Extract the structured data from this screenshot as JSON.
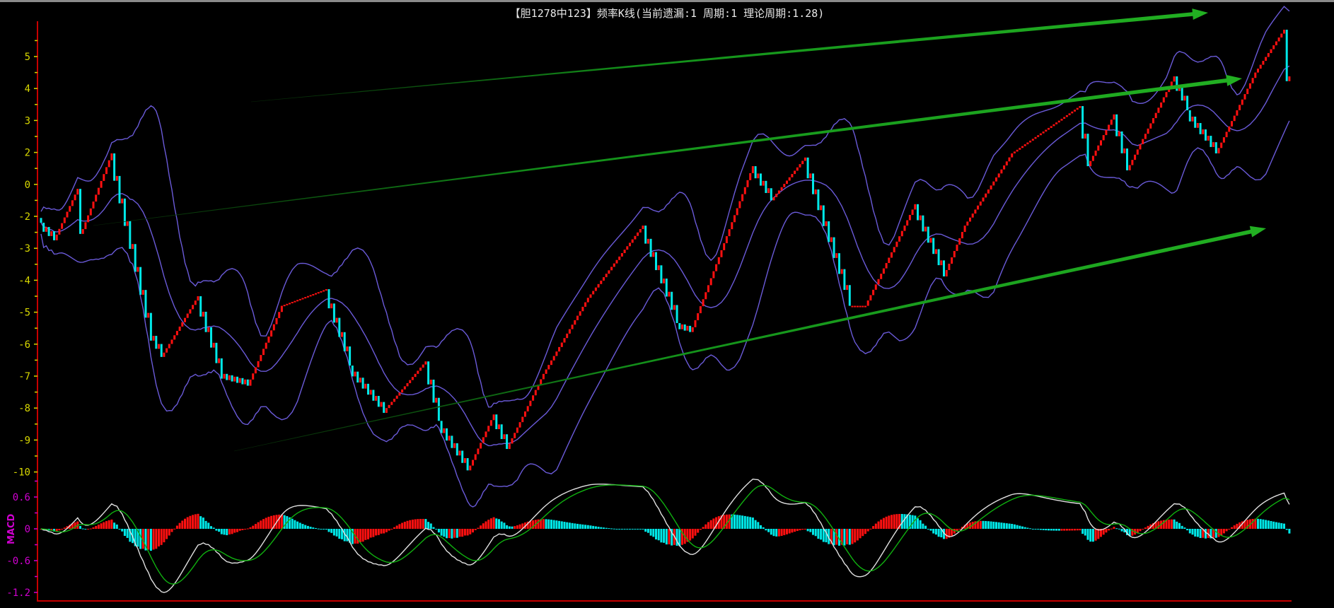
{
  "title": "【胆1278中123】频率K线(当前遗漏:1 周期:1 理论周期:1.28)",
  "colors": {
    "up": "#ff1010",
    "down": "#00e8e8",
    "band": "#6a5ad8",
    "axis": "#c80000",
    "tick_text": "#d8d800",
    "macd_text": "#d000d0",
    "dif": "#e0e0e0",
    "dea": "#10b010",
    "arrow": "#22b022"
  },
  "chart_data": [
    {
      "type": "candlestick",
      "title": "【胆1278中123】频率K线(当前遗漏:1 周期:1 理论周期:1.28)",
      "y_tick_labels": [
        "5",
        "4",
        "3",
        "2",
        "0",
        "-2",
        "-3",
        "-4",
        "-5",
        "-6",
        "-7",
        "-8",
        "-9",
        "-10"
      ],
      "y_tick_levels": [
        5,
        4,
        3,
        2,
        1,
        0,
        -1,
        -2,
        -3,
        -4,
        -5,
        -6,
        -7,
        -8
      ],
      "ylim": [
        -8.3,
        6.0
      ],
      "up_step": 0.15,
      "indicators": [
        "BOLL(20,2)"
      ],
      "close_pivots": [
        [
          0,
          -0.2
        ],
        [
          5,
          -0.75
        ],
        [
          14,
          0.86
        ],
        [
          16,
          -0.4
        ],
        [
          27,
          1.97
        ],
        [
          33,
          -0.15
        ],
        [
          43,
          -3.74
        ],
        [
          46,
          -4.4
        ],
        [
          60,
          -2.5
        ],
        [
          70,
          -4.93
        ],
        [
          79,
          -5.3
        ],
        [
          92,
          -2.8
        ],
        [
          109,
          -2.28
        ],
        [
          118,
          -4.67
        ],
        [
          132,
          -6.0
        ],
        [
          147,
          -4.54
        ],
        [
          152,
          -6.4
        ],
        [
          164,
          -7.8
        ],
        [
          173,
          -6.2
        ],
        [
          178,
          -7.28
        ],
        [
          192,
          -4.93
        ],
        [
          209,
          -2.55
        ],
        [
          230,
          -0.29
        ],
        [
          243,
          -3.34
        ],
        [
          249,
          -3.47
        ],
        [
          272,
          1.57
        ],
        [
          279,
          0.5
        ],
        [
          292,
          1.84
        ],
        [
          309,
          -2.8
        ],
        [
          315,
          -2.8
        ],
        [
          334,
          0.38
        ],
        [
          345,
          -1.88
        ],
        [
          353,
          -0.29
        ],
        [
          371,
          1.97
        ],
        [
          397,
          3.45
        ],
        [
          400,
          1.57
        ],
        [
          410,
          3.19
        ],
        [
          415,
          1.44
        ],
        [
          433,
          4.38
        ],
        [
          438,
          3.32
        ],
        [
          449,
          1.97
        ],
        [
          464,
          4.5
        ],
        [
          475,
          5.84
        ],
        [
          477,
          4.38
        ]
      ]
    },
    {
      "type": "macd",
      "label": "MACD",
      "y_tick_labels": [
        "0.6",
        "0",
        "-0.6",
        "-1.2"
      ],
      "y_tick_values": [
        0.6,
        0,
        -0.6,
        -1.2
      ],
      "params": [
        12,
        26,
        9
      ]
    }
  ]
}
